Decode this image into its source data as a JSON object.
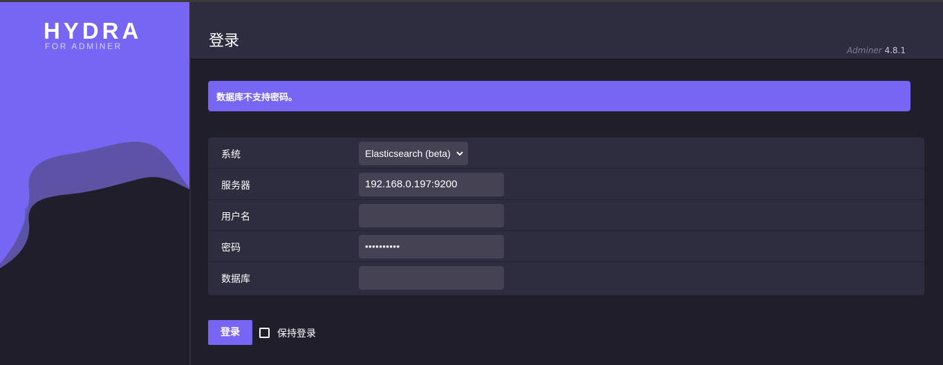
{
  "logo": {
    "main": "HYDRA",
    "sub": "FOR ADMINER"
  },
  "header": {
    "title": "登录",
    "app_name": "Adminer",
    "version": "4.8.1"
  },
  "error": {
    "message": "数据库不支持密码。"
  },
  "form": {
    "system": {
      "label": "系统",
      "value": "Elasticsearch (beta)"
    },
    "server": {
      "label": "服务器",
      "value": "192.168.0.197:9200"
    },
    "username": {
      "label": "用户名",
      "value": ""
    },
    "password": {
      "label": "密码",
      "value": "••••••••••"
    },
    "database": {
      "label": "数据库",
      "value": ""
    }
  },
  "actions": {
    "login_label": "登录",
    "remember_label": "保持登录",
    "remember_checked": false
  },
  "colors": {
    "accent": "#7765f3",
    "background": "#201e2b",
    "panel": "#2e2c3f",
    "input": "#454254"
  }
}
